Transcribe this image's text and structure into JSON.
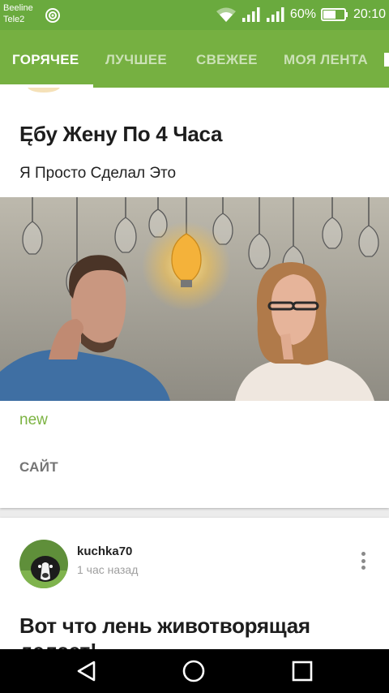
{
  "status_bar": {
    "carrier1": "Beeline",
    "carrier2": "Tele2",
    "battery": "60%",
    "time": "20:10",
    "icons": [
      "cast-icon",
      "wifi-icon",
      "signal-icon",
      "signal-icon",
      "battery-icon"
    ]
  },
  "tabs": [
    {
      "label": "ГОРЯЧЕЕ",
      "active": true
    },
    {
      "label": "ЛУЧШЕЕ",
      "active": false
    },
    {
      "label": "СВЕЖЕЕ",
      "active": false
    },
    {
      "label": "МОЯ ЛЕНТА",
      "active": false
    }
  ],
  "posts": [
    {
      "title": "Ęбу Жену По 4 Часа",
      "subtitle": "Я Просто Сделал Это",
      "tag": "new",
      "source": "САЙТ"
    },
    {
      "author": "kuchka70",
      "time": "1 час назад",
      "title": "Вот что лень животворящая делает!"
    }
  ],
  "colors": {
    "status_bar": "#6aaa3e",
    "app_bar": "#76b041",
    "tag": "#7cb342"
  },
  "nav": {
    "icons": [
      "back-icon",
      "home-icon",
      "recents-icon"
    ]
  }
}
